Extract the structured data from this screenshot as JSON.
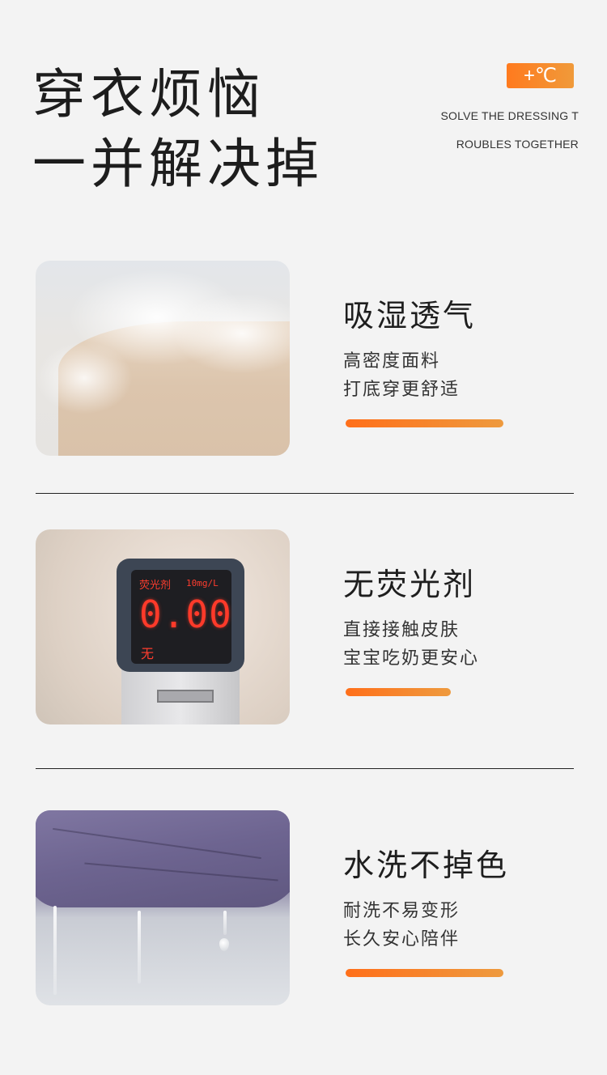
{
  "header": {
    "title_line1": "穿衣烦恼",
    "title_line2": "一并解决掉",
    "badge": "+℃",
    "subtitle_en_line1": "SOLVE THE DRESSING T",
    "subtitle_en_line2": "ROUBLES TOGETHER"
  },
  "features": [
    {
      "title": "吸湿透气",
      "line1": "高密度面料",
      "line2": "打底穿更舒适",
      "bar_fraction": 0.87
    },
    {
      "title": "无荧光剂",
      "line1": "直接接触皮肤",
      "line2": "宝宝吃奶更安心",
      "bar_fraction": 0.58,
      "device": {
        "label": "荧光剂",
        "unit": "10mg/L",
        "value": "0.00",
        "result": "无"
      }
    },
    {
      "title": "水洗不掉色",
      "line1": "耐洗不易变形",
      "line2": "长久安心陪伴",
      "bar_fraction": 0.87
    }
  ],
  "colors": {
    "accent_start": "#ff6f1a",
    "accent_end": "#ee9a3e",
    "background": "#f3f3f3",
    "text": "#1e1e1e"
  }
}
